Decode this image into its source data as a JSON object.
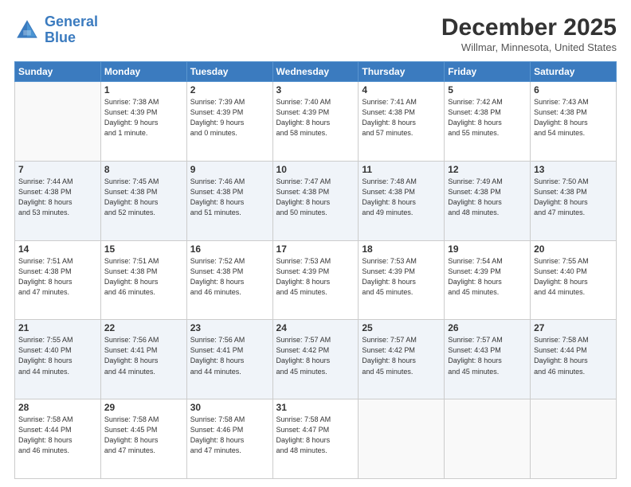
{
  "header": {
    "logo_line1": "General",
    "logo_line2": "Blue",
    "title": "December 2025",
    "subtitle": "Willmar, Minnesota, United States"
  },
  "weekdays": [
    "Sunday",
    "Monday",
    "Tuesday",
    "Wednesday",
    "Thursday",
    "Friday",
    "Saturday"
  ],
  "weeks": [
    [
      {
        "day": "",
        "info": ""
      },
      {
        "day": "1",
        "info": "Sunrise: 7:38 AM\nSunset: 4:39 PM\nDaylight: 9 hours\nand 1 minute."
      },
      {
        "day": "2",
        "info": "Sunrise: 7:39 AM\nSunset: 4:39 PM\nDaylight: 9 hours\nand 0 minutes."
      },
      {
        "day": "3",
        "info": "Sunrise: 7:40 AM\nSunset: 4:39 PM\nDaylight: 8 hours\nand 58 minutes."
      },
      {
        "day": "4",
        "info": "Sunrise: 7:41 AM\nSunset: 4:38 PM\nDaylight: 8 hours\nand 57 minutes."
      },
      {
        "day": "5",
        "info": "Sunrise: 7:42 AM\nSunset: 4:38 PM\nDaylight: 8 hours\nand 55 minutes."
      },
      {
        "day": "6",
        "info": "Sunrise: 7:43 AM\nSunset: 4:38 PM\nDaylight: 8 hours\nand 54 minutes."
      }
    ],
    [
      {
        "day": "7",
        "info": "Sunrise: 7:44 AM\nSunset: 4:38 PM\nDaylight: 8 hours\nand 53 minutes."
      },
      {
        "day": "8",
        "info": "Sunrise: 7:45 AM\nSunset: 4:38 PM\nDaylight: 8 hours\nand 52 minutes."
      },
      {
        "day": "9",
        "info": "Sunrise: 7:46 AM\nSunset: 4:38 PM\nDaylight: 8 hours\nand 51 minutes."
      },
      {
        "day": "10",
        "info": "Sunrise: 7:47 AM\nSunset: 4:38 PM\nDaylight: 8 hours\nand 50 minutes."
      },
      {
        "day": "11",
        "info": "Sunrise: 7:48 AM\nSunset: 4:38 PM\nDaylight: 8 hours\nand 49 minutes."
      },
      {
        "day": "12",
        "info": "Sunrise: 7:49 AM\nSunset: 4:38 PM\nDaylight: 8 hours\nand 48 minutes."
      },
      {
        "day": "13",
        "info": "Sunrise: 7:50 AM\nSunset: 4:38 PM\nDaylight: 8 hours\nand 47 minutes."
      }
    ],
    [
      {
        "day": "14",
        "info": "Sunrise: 7:51 AM\nSunset: 4:38 PM\nDaylight: 8 hours\nand 47 minutes."
      },
      {
        "day": "15",
        "info": "Sunrise: 7:51 AM\nSunset: 4:38 PM\nDaylight: 8 hours\nand 46 minutes."
      },
      {
        "day": "16",
        "info": "Sunrise: 7:52 AM\nSunset: 4:38 PM\nDaylight: 8 hours\nand 46 minutes."
      },
      {
        "day": "17",
        "info": "Sunrise: 7:53 AM\nSunset: 4:39 PM\nDaylight: 8 hours\nand 45 minutes."
      },
      {
        "day": "18",
        "info": "Sunrise: 7:53 AM\nSunset: 4:39 PM\nDaylight: 8 hours\nand 45 minutes."
      },
      {
        "day": "19",
        "info": "Sunrise: 7:54 AM\nSunset: 4:39 PM\nDaylight: 8 hours\nand 45 minutes."
      },
      {
        "day": "20",
        "info": "Sunrise: 7:55 AM\nSunset: 4:40 PM\nDaylight: 8 hours\nand 44 minutes."
      }
    ],
    [
      {
        "day": "21",
        "info": "Sunrise: 7:55 AM\nSunset: 4:40 PM\nDaylight: 8 hours\nand 44 minutes."
      },
      {
        "day": "22",
        "info": "Sunrise: 7:56 AM\nSunset: 4:41 PM\nDaylight: 8 hours\nand 44 minutes."
      },
      {
        "day": "23",
        "info": "Sunrise: 7:56 AM\nSunset: 4:41 PM\nDaylight: 8 hours\nand 44 minutes."
      },
      {
        "day": "24",
        "info": "Sunrise: 7:57 AM\nSunset: 4:42 PM\nDaylight: 8 hours\nand 45 minutes."
      },
      {
        "day": "25",
        "info": "Sunrise: 7:57 AM\nSunset: 4:42 PM\nDaylight: 8 hours\nand 45 minutes."
      },
      {
        "day": "26",
        "info": "Sunrise: 7:57 AM\nSunset: 4:43 PM\nDaylight: 8 hours\nand 45 minutes."
      },
      {
        "day": "27",
        "info": "Sunrise: 7:58 AM\nSunset: 4:44 PM\nDaylight: 8 hours\nand 46 minutes."
      }
    ],
    [
      {
        "day": "28",
        "info": "Sunrise: 7:58 AM\nSunset: 4:44 PM\nDaylight: 8 hours\nand 46 minutes."
      },
      {
        "day": "29",
        "info": "Sunrise: 7:58 AM\nSunset: 4:45 PM\nDaylight: 8 hours\nand 47 minutes."
      },
      {
        "day": "30",
        "info": "Sunrise: 7:58 AM\nSunset: 4:46 PM\nDaylight: 8 hours\nand 47 minutes."
      },
      {
        "day": "31",
        "info": "Sunrise: 7:58 AM\nSunset: 4:47 PM\nDaylight: 8 hours\nand 48 minutes."
      },
      {
        "day": "",
        "info": ""
      },
      {
        "day": "",
        "info": ""
      },
      {
        "day": "",
        "info": ""
      }
    ]
  ]
}
